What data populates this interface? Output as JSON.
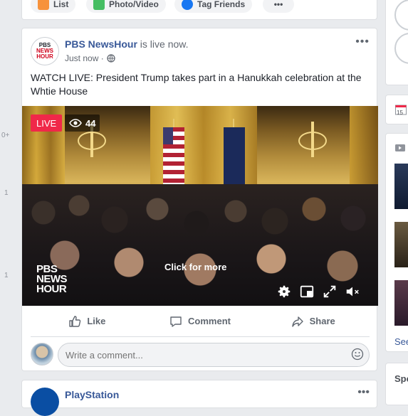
{
  "composer": {
    "list_label": "List",
    "photo_label": "Photo/Video",
    "tag_label": "Tag Friends",
    "more_label": "•••"
  },
  "gutter": {
    "n1": "0+",
    "n2": "1",
    "n3": "1"
  },
  "post": {
    "page_logo": {
      "line1": "PBS",
      "line2": "NEWS",
      "line3": "HOUR"
    },
    "page_name": "PBS NewsHour",
    "status": " is live now.",
    "time": "Just now ·",
    "options_label": "•••",
    "text": "WATCH LIVE: President Trump takes part in a Hanukkah celebration at the Whtie House",
    "video": {
      "live_label": "LIVE",
      "viewer_count": "44",
      "overlay_text": "Click for more",
      "watermark_line1": "PBS",
      "watermark_line2": "NEWS",
      "watermark_line3": "HOUR"
    },
    "actions": {
      "like": "Like",
      "comment": "Comment",
      "share": "Share"
    },
    "comment_placeholder": "Write a comment..."
  },
  "next_post": {
    "page_name": "PlayStation",
    "options_label": "•••"
  },
  "right_column": {
    "see_label": "See",
    "sponsored_label": "Spo",
    "calendar_day": "15"
  },
  "colors": {
    "live_red": "#f02849",
    "link_blue": "#385898",
    "background": "#e9ebee"
  }
}
